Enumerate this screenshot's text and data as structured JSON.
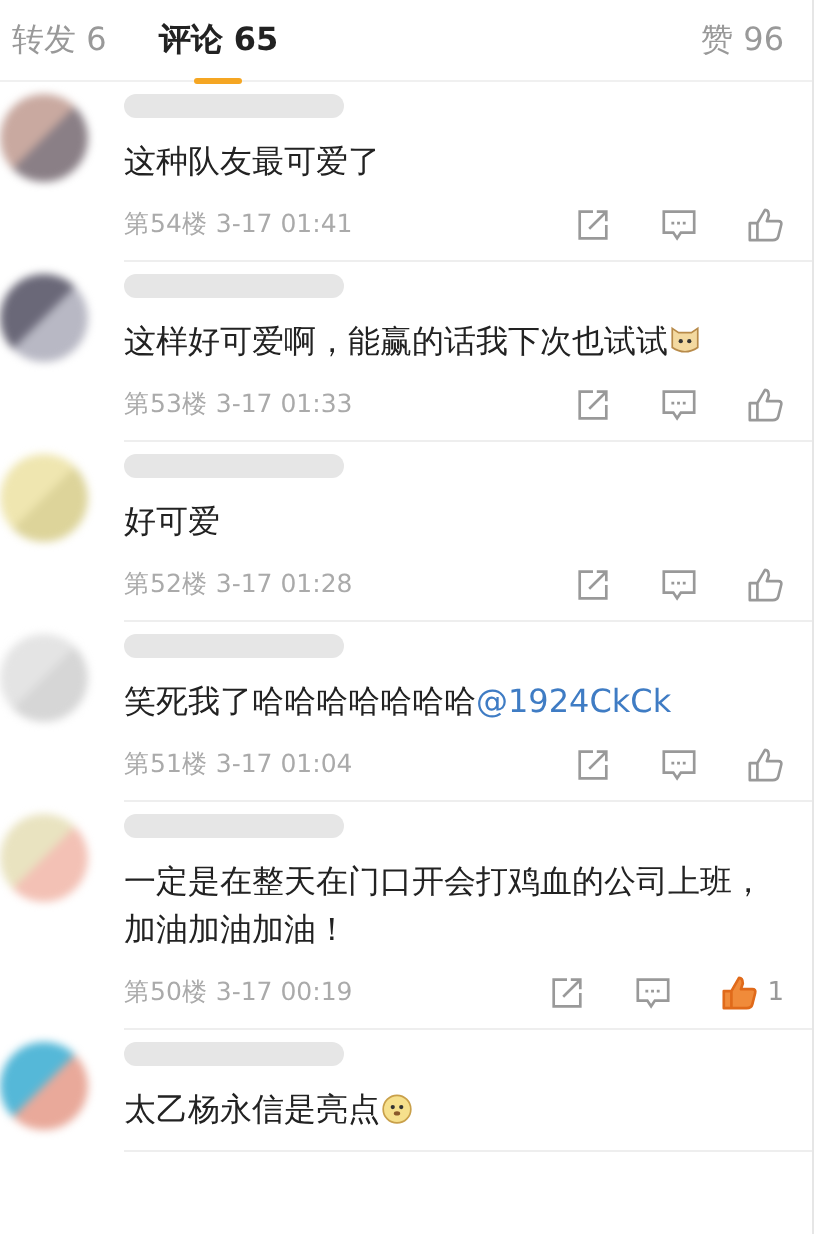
{
  "tabs": [
    {
      "label": "转发 6",
      "selected": false
    },
    {
      "label": "评论 65",
      "selected": true
    },
    {
      "label": "赞 96",
      "selected": false
    }
  ],
  "comments": [
    {
      "text": "这种队友最可爱了",
      "floor": "第54楼",
      "time": "3-17 01:41",
      "liked": false
    },
    {
      "text": "这样好可爱啊，能赢的话我下次也试试",
      "emoji": {
        "kind": "cat"
      },
      "floor": "第53楼",
      "time": "3-17 01:33",
      "liked": false
    },
    {
      "text": "好可爱",
      "floor": "第52楼",
      "time": "3-17 01:28",
      "liked": false
    },
    {
      "text": "笑死我了哈哈哈哈哈哈哈",
      "mention": "@1924CkCk",
      "floor": "第51楼",
      "time": "3-17 01:04",
      "liked": false
    },
    {
      "text": "一定是在整天在门口开会打鸡血的公司上班，加油加油加油！",
      "floor": "第50楼",
      "time": "3-17 00:19",
      "liked": true,
      "like_count": "1"
    },
    {
      "text": "太乙杨永信是亮点",
      "emoji": {
        "kind": "dog"
      }
    }
  ]
}
